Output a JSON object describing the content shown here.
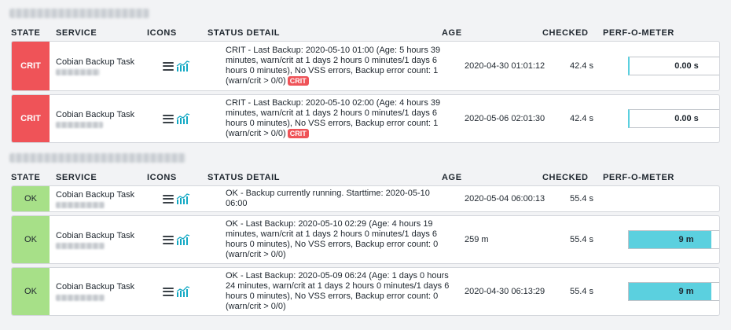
{
  "columns": {
    "state": "STATE",
    "service": "SERVICE",
    "icons": "ICONS",
    "status_detail": "STATUS DETAIL",
    "age": "AGE",
    "checked": "CHECKED",
    "perf": "PERF-O-METER"
  },
  "colors": {
    "crit": "#ef5358",
    "ok": "#a7e088",
    "perf_fill": "#5bd0df"
  },
  "icons": [
    "menu-icon",
    "graph-icon"
  ],
  "groups": [
    {
      "rows": [
        {
          "state": "CRIT",
          "service": "Cobian Backup Task",
          "detail": "CRIT - Last Backup: 2020-05-10 01:00 (Age: 5 hours 39 minutes, warn/crit at 1 days 2 hours 0 minutes/1 days 6 hours 0 minutes), No VSS errors, Backup error count: 1 (warn/crit > 0/0)",
          "detail_badge": "CRIT",
          "age": "2020-04-30 01:01:12",
          "checked": "42.4 s",
          "perf": "0.00 s"
        },
        {
          "state": "CRIT",
          "service": "Cobian Backup Task",
          "detail": "CRIT - Last Backup: 2020-05-10 02:00 (Age: 4 hours 39 minutes, warn/crit at 1 days 2 hours 0 minutes/1 days 6 hours 0 minutes), No VSS errors, Backup error count: 1 (warn/crit > 0/0)",
          "detail_badge": "CRIT",
          "age": "2020-05-06 02:01:30",
          "checked": "42.4 s",
          "perf": "0.00 s"
        }
      ]
    },
    {
      "rows": [
        {
          "state": "OK",
          "service": "Cobian Backup Task",
          "detail": "OK - Backup currently running. Starttime: 2020-05-10 06:00",
          "age": "2020-05-04 06:00:13",
          "checked": "55.4 s"
        },
        {
          "state": "OK",
          "service": "Cobian Backup Task",
          "detail": "OK - Last Backup: 2020-05-10 02:29 (Age: 4 hours 19 minutes, warn/crit at 1 days 2 hours 0 minutes/1 days 6 hours 0 minutes), No VSS errors, Backup error count: 0 (warn/crit > 0/0)",
          "age": "259 m",
          "checked": "55.4 s",
          "perf": "9 m",
          "perf_fraction": 0.72
        },
        {
          "state": "OK",
          "service": "Cobian Backup Task",
          "detail": "OK - Last Backup: 2020-05-09 06:24 (Age: 1 days 0 hours 24 minutes, warn/crit at 1 days 2 hours 0 minutes/1 days 6 hours 0 minutes), No VSS errors, Backup error count: 0 (warn/crit > 0/0)",
          "age": "2020-04-30 06:13:29",
          "checked": "55.4 s",
          "perf": "9 m",
          "perf_fraction": 0.72
        }
      ]
    }
  ]
}
